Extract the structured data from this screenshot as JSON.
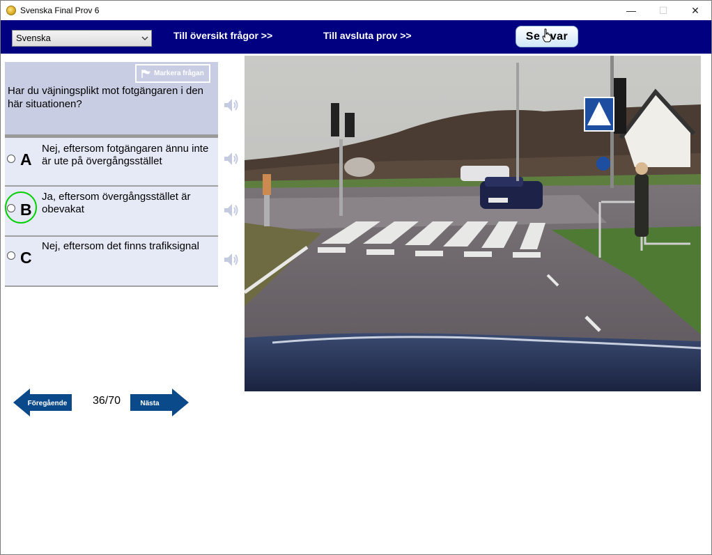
{
  "window": {
    "title": "Svenska Final Prov 6",
    "controls": {
      "minimize": "—",
      "maximize": "☐",
      "close": "✕"
    }
  },
  "toolbar": {
    "language": "Svenska",
    "overview_link": "Till översikt frågor >>",
    "finish_link": "Till avsluta prov  >>",
    "answer_button": "Se svar"
  },
  "question": {
    "flag_button": "Markera frågan",
    "text": "Har du väjningsplikt mot fotgängaren i den här situationen?"
  },
  "options": [
    {
      "letter": "A",
      "text": "Nej, eftersom fotgängaren ännu inte är ute på övergångsstället",
      "selected": false
    },
    {
      "letter": "B",
      "text": "Ja, eftersom övergångsstället är obevakat",
      "selected": false,
      "highlighted": true
    },
    {
      "letter": "C",
      "text": "Nej, eftersom det finns trafiksignal",
      "selected": false
    }
  ],
  "navigation": {
    "previous": "Föregående",
    "next": "Nästa",
    "counter": "36/70"
  },
  "colors": {
    "toolbar_bg": "#000080",
    "question_bg": "#c8cde3",
    "option_bg": "#e6eaf7",
    "nav_arrow": "#0a4a8a",
    "highlight": "#00d000"
  },
  "icons": [
    "app-icon",
    "chevron-down-icon",
    "flag-icon",
    "speaker-icon",
    "hand-cursor-icon",
    "arrow-left-icon",
    "arrow-right-icon"
  ]
}
